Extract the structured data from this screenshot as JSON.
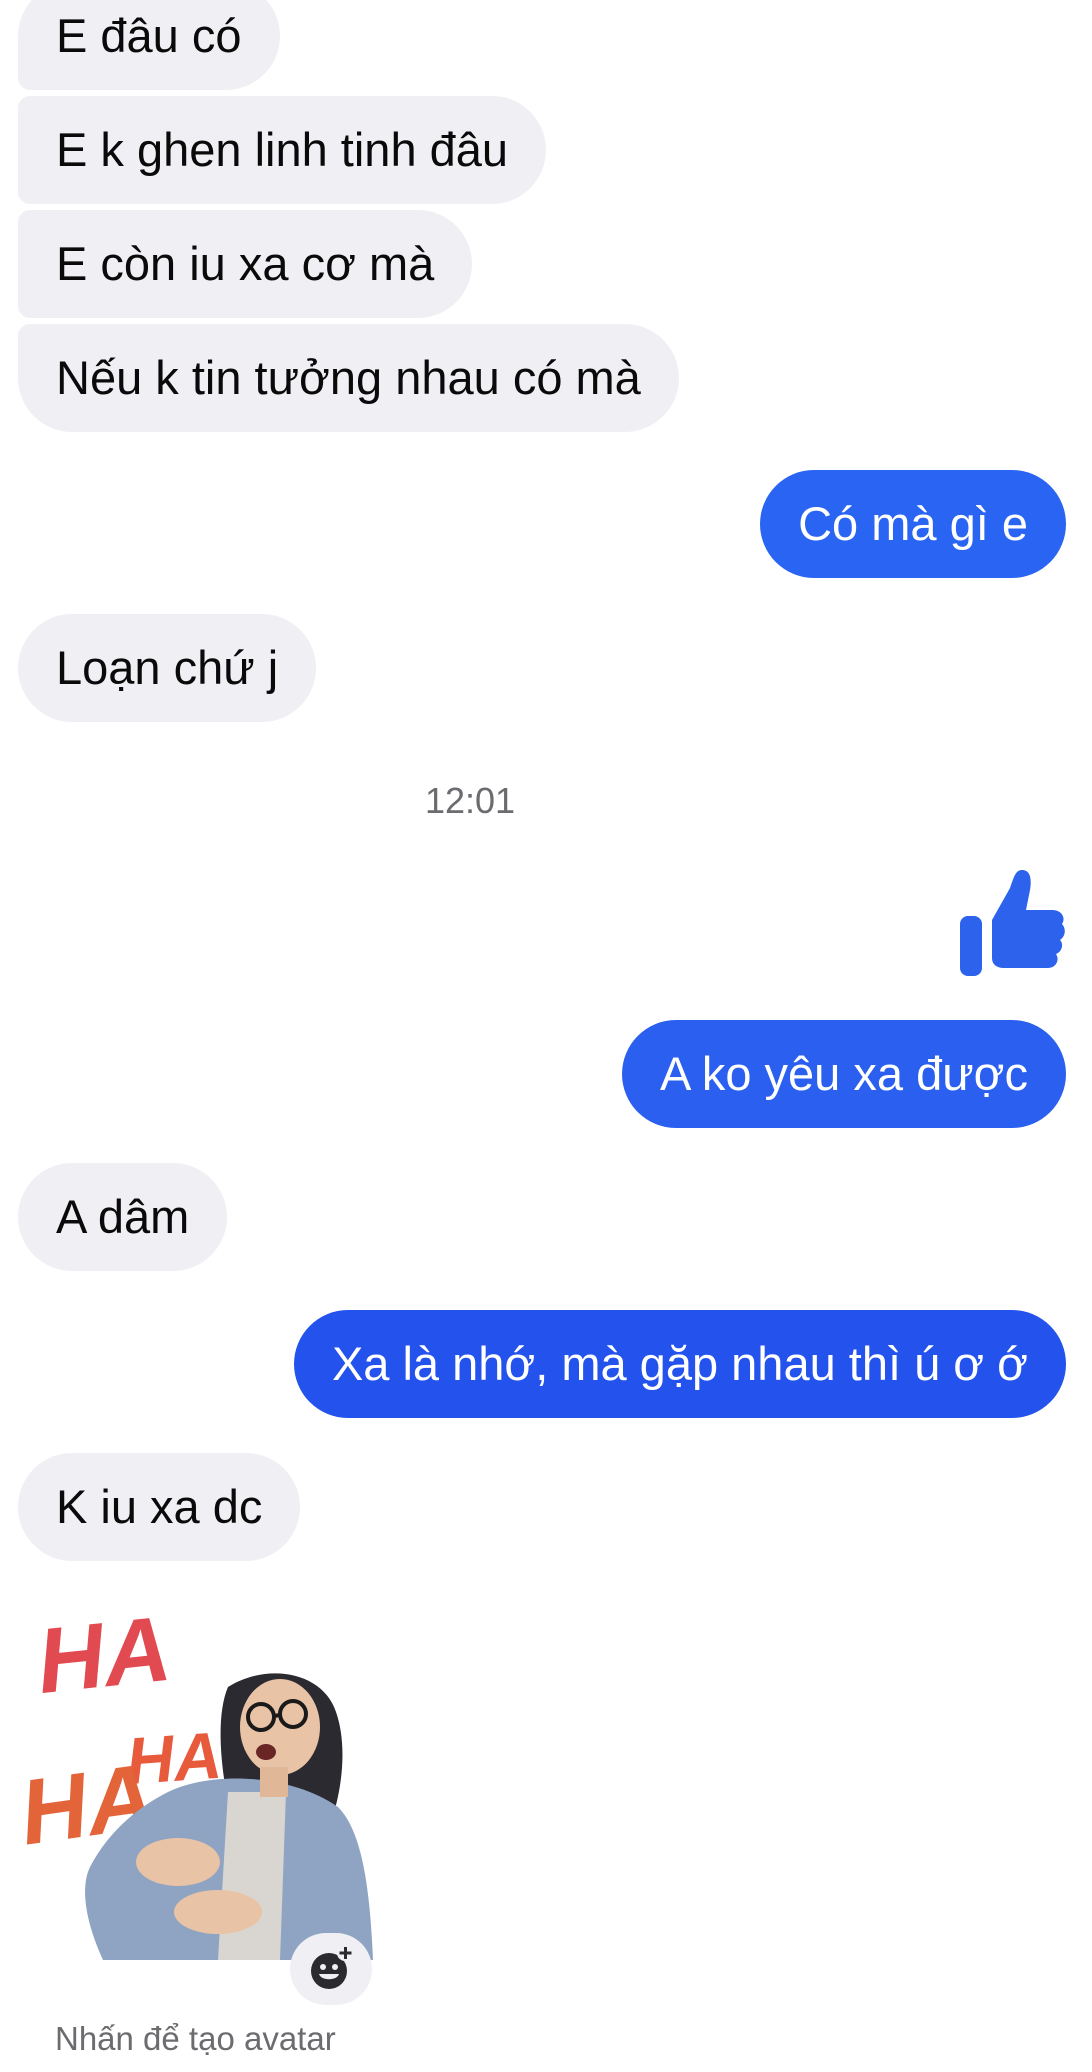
{
  "messages": {
    "m1": "E đâu có",
    "m2": "E k ghen linh tinh đâu",
    "m3": "E còn iu xa cơ mà",
    "m4": "Nếu k tin tưởng nhau có mà",
    "m5": "Có mà gì e",
    "m6": "Loạn chứ j",
    "m7": "A ko yêu xa được",
    "m8": "A dâm",
    "m9": "Xa là nhớ, mà gặp nhau thì ú ơ ớ",
    "m10": "K iu xa dc"
  },
  "timestamp": "12:01",
  "sticker": {
    "text_top": "HA",
    "text_mid": "HA",
    "text_left": "HA"
  },
  "avatar_caption": "Nhấn để tạo avatar",
  "colors": {
    "outgoing_bubble": "#2a5ff0",
    "incoming_bubble": "#f0f0f4",
    "like_icon": "#2d63ec"
  }
}
